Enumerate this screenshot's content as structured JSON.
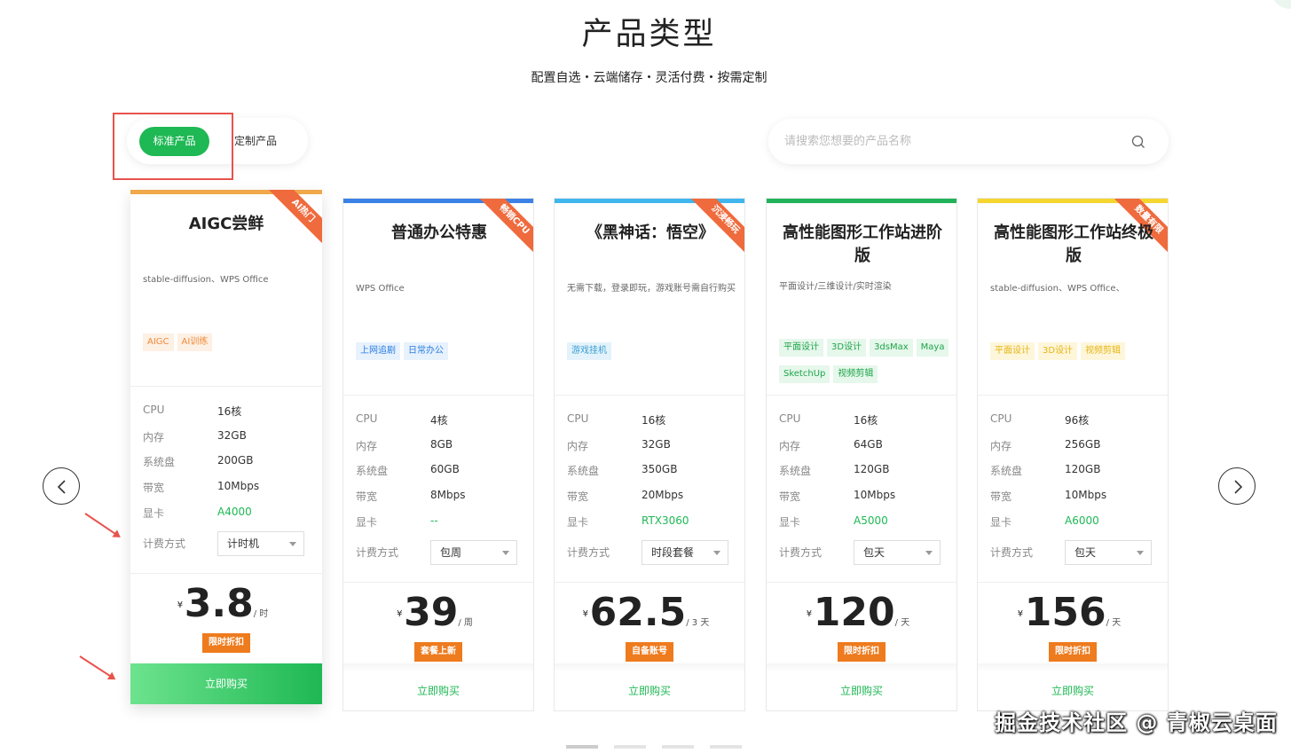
{
  "header": {
    "title": "产品类型",
    "subtitle": "配置自选・云端储存・灵活付费・按需定制"
  },
  "tabs": {
    "standard": "标准产品",
    "custom": "定制产品"
  },
  "search": {
    "placeholder": "请搜索您想要的产品名称",
    "icon": "search-icon"
  },
  "spec_labels": {
    "cpu": "CPU",
    "memory": "内存",
    "disk": "系统盘",
    "bandwidth": "带宽",
    "gpu": "显卡",
    "billing": "计费方式"
  },
  "currency": "¥",
  "buy_label": "立即购买",
  "cards": [
    {
      "name": "AIGC尝鲜",
      "ribbon": "AI热门",
      "desc": "stable-diffusion、WPS Office",
      "tags": [
        "AIGC",
        "AI训练"
      ],
      "cpu": "16核",
      "memory": "32GB",
      "disk": "200GB",
      "bandwidth": "10Mbps",
      "gpu": "A4000",
      "billing": "计时机",
      "price": "3.8",
      "unit": "/ 时",
      "badge": "限时折扣",
      "bar_color": "#f0a94a"
    },
    {
      "name": "普通办公特惠",
      "ribbon": "畅销CPU",
      "desc": "WPS Office",
      "tags": [
        "上网追剧",
        "日常办公"
      ],
      "cpu": "4核",
      "memory": "8GB",
      "disk": "60GB",
      "bandwidth": "8Mbps",
      "gpu": "--",
      "billing": "包周",
      "price": "39",
      "unit": "/ 周",
      "badge": "套餐上新",
      "bar_color": "#3b82e6"
    },
    {
      "name": "《黑神话：悟空》",
      "ribbon": "沉浸畅玩",
      "desc": "无需下载，登录即玩，游戏账号需自行购买",
      "tags": [
        "游戏挂机"
      ],
      "cpu": "16核",
      "memory": "32GB",
      "disk": "350GB",
      "bandwidth": "20Mbps",
      "gpu": "RTX3060",
      "billing": "时段套餐",
      "price": "62.5",
      "unit": "/ 3 天",
      "badge": "自备账号",
      "bar_color": "#3fb6ee"
    },
    {
      "name": "高性能图形工作站进阶版",
      "ribbon": "",
      "desc": "平面设计/三维设计/实时渲染",
      "tags": [
        "平面设计",
        "3D设计",
        "3dsMax",
        "Maya",
        "SketchUp",
        "视频剪辑"
      ],
      "cpu": "16核",
      "memory": "64GB",
      "disk": "120GB",
      "bandwidth": "10Mbps",
      "gpu": "A5000",
      "billing": "包天",
      "price": "120",
      "unit": "/ 天",
      "badge": "限时折扣",
      "bar_color": "#22b25a"
    },
    {
      "name": "高性能图形工作站终极版",
      "ribbon": "数量有限",
      "desc": "stable-diffusion、WPS Office、",
      "tags": [
        "平面设计",
        "3D设计",
        "视频剪辑"
      ],
      "cpu": "96核",
      "memory": "256GB",
      "disk": "120GB",
      "bandwidth": "10Mbps",
      "gpu": "A6000",
      "billing": "包天",
      "price": "156",
      "unit": "/ 天",
      "badge": "限时折扣",
      "bar_color": "#f5d631"
    }
  ],
  "watermark": "掘金技术社区 @ 青椒云桌面",
  "colors": {
    "brand_green": "#1eb854",
    "badge_orange": "#ee7b1e",
    "ribbon_orange": "#ef6a3c",
    "annotation_red": "#e8534c"
  }
}
